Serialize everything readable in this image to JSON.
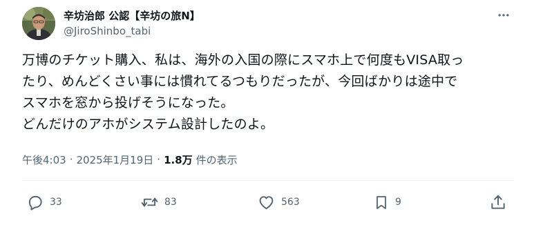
{
  "author": {
    "display_name": "辛坊治郎 公認【辛坊の旅N】",
    "handle": "@JiroShinbo_tabi"
  },
  "tweet": {
    "lines": [
      "万博のチケット購入、私は、海外の入国の際にスマホ上で何度もVISA取っ",
      "たり、めんどくさい事には慣れてるつもりだったが、今回ばかりは途中で",
      "スマホを窓から投げそうになった。",
      "どんだけのアホがシステム設計したのよ。"
    ]
  },
  "meta": {
    "time": "午後4:03",
    "separator": "·",
    "date": "2025年1月19日",
    "views_count": "1.8万",
    "views_label": "件の表示"
  },
  "actions": {
    "reply_count": "33",
    "retweet_count": "83",
    "like_count": "563",
    "bookmark_count": "9"
  },
  "colors": {
    "text_primary": "#0f1419",
    "text_secondary": "#536471",
    "divider": "#eff3f4"
  },
  "icons": {
    "more": "more-horizontal-icon",
    "reply": "reply-icon",
    "retweet": "retweet-icon",
    "like": "heart-icon",
    "bookmark": "bookmark-icon",
    "share": "share-icon"
  }
}
